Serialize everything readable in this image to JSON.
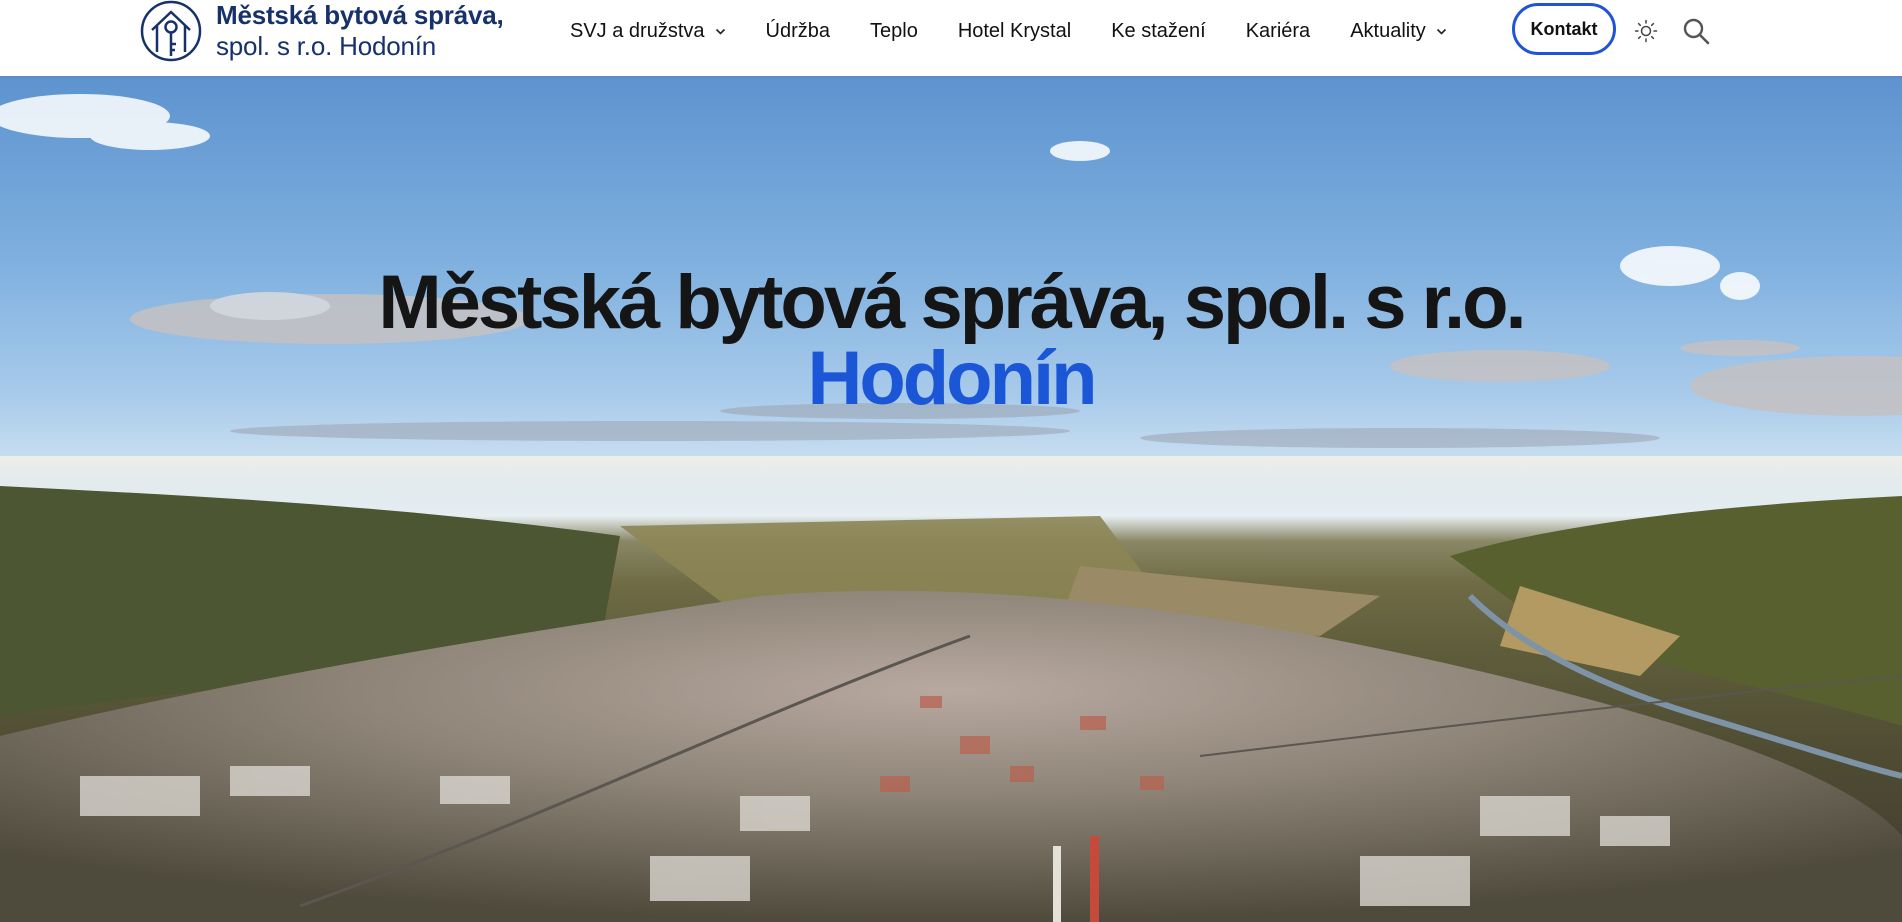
{
  "brand": {
    "line1": "Městská bytová správa,",
    "line2": "spol. s r.o. Hodonín",
    "logo_icon": "house-key-icon",
    "color": "#17316b"
  },
  "nav": {
    "items": [
      {
        "label": "SVJ a družstva",
        "has_dropdown": true
      },
      {
        "label": "Údržba",
        "has_dropdown": false
      },
      {
        "label": "Teplo",
        "has_dropdown": false
      },
      {
        "label": "Hotel Krystal",
        "has_dropdown": false
      },
      {
        "label": "Ke stažení",
        "has_dropdown": false
      },
      {
        "label": "Kariéra",
        "has_dropdown": false
      },
      {
        "label": "Aktuality",
        "has_dropdown": true
      }
    ],
    "contact_label": "Kontakt",
    "theme_icon": "sun-icon",
    "search_icon": "search-icon",
    "accent": "#1f54d8"
  },
  "hero": {
    "title_line1": "Městská bytová správa, spol. s r.o.",
    "title_line2": "Hodonín",
    "title_color": "#151515",
    "accent_color": "#1a56d6",
    "background": "aerial-city-photo"
  }
}
